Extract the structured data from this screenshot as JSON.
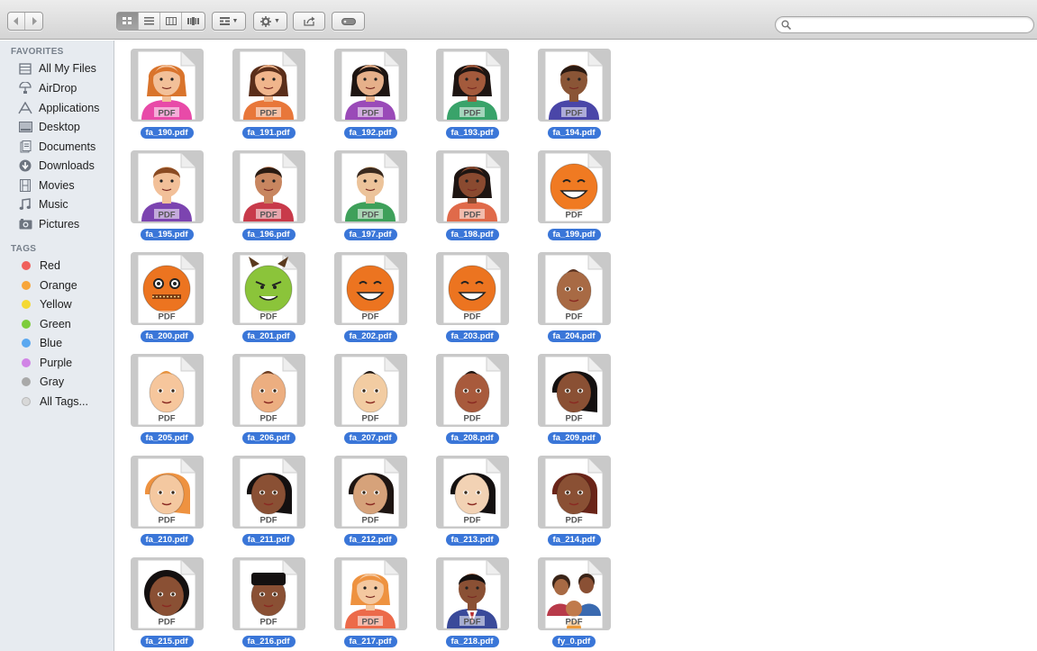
{
  "toolbar": {
    "back_icon": "chevron-left-icon",
    "forward_icon": "chevron-right-icon",
    "view_icons": [
      "icon-view-icon",
      "list-view-icon",
      "column-view-icon",
      "cover-flow-icon"
    ],
    "arrange_icon": "arrange-icon",
    "action_icon": "gear-icon",
    "share_icon": "share-icon",
    "tag_icon": "tag-icon"
  },
  "search": {
    "value": "",
    "placeholder": ""
  },
  "sidebar": {
    "favorites_header": "FAVORITES",
    "favorites": [
      {
        "label": "All My Files",
        "icon": "all-files-icon"
      },
      {
        "label": "AirDrop",
        "icon": "airdrop-icon"
      },
      {
        "label": "Applications",
        "icon": "applications-icon"
      },
      {
        "label": "Desktop",
        "icon": "desktop-icon"
      },
      {
        "label": "Documents",
        "icon": "documents-icon"
      },
      {
        "label": "Downloads",
        "icon": "downloads-icon"
      },
      {
        "label": "Movies",
        "icon": "movies-icon"
      },
      {
        "label": "Music",
        "icon": "music-icon"
      },
      {
        "label": "Pictures",
        "icon": "pictures-icon"
      }
    ],
    "tags_header": "TAGS",
    "tags": [
      {
        "label": "Red",
        "color": "#f0605c"
      },
      {
        "label": "Orange",
        "color": "#f7a53a"
      },
      {
        "label": "Yellow",
        "color": "#f4d934"
      },
      {
        "label": "Green",
        "color": "#7dcc3c"
      },
      {
        "label": "Blue",
        "color": "#5aa8f0"
      },
      {
        "label": "Purple",
        "color": "#d184e6"
      },
      {
        "label": "Gray",
        "color": "#a9a9a9"
      },
      {
        "label": "All Tags...",
        "color": "#d8d8d8"
      }
    ]
  },
  "files": [
    {
      "name": "fa_190.pdf",
      "kind": "woman",
      "skin": "#f2c099",
      "hair": "#d9742c",
      "shirt": "#e84aa8"
    },
    {
      "name": "fa_191.pdf",
      "kind": "woman",
      "skin": "#f0b58c",
      "hair": "#5a2e1a",
      "shirt": "#e8773a"
    },
    {
      "name": "fa_192.pdf",
      "kind": "woman",
      "skin": "#e6b08a",
      "hair": "#1e1512",
      "shirt": "#9a4ab8"
    },
    {
      "name": "fa_193.pdf",
      "kind": "woman",
      "skin": "#a35a3c",
      "hair": "#1e1512",
      "shirt": "#39a36a"
    },
    {
      "name": "fa_194.pdf",
      "kind": "man",
      "skin": "#8a5536",
      "hair": "#2a1a12",
      "shirt": "#4a46a8"
    },
    {
      "name": "fa_195.pdf",
      "kind": "man",
      "skin": "#f2c099",
      "hair": "#8a4a22",
      "shirt": "#7c44b0"
    },
    {
      "name": "fa_196.pdf",
      "kind": "man",
      "skin": "#c88660",
      "hair": "#2a1a12",
      "shirt": "#c83a4a"
    },
    {
      "name": "fa_197.pdf",
      "kind": "man",
      "skin": "#ecc39a",
      "hair": "#3a2a1e",
      "shirt": "#3ea05a"
    },
    {
      "name": "fa_198.pdf",
      "kind": "woman",
      "skin": "#8a4a30",
      "hair": "#1e1512",
      "shirt": "#e06a4a"
    },
    {
      "name": "fa_199.pdf",
      "kind": "smiley",
      "skin": "#f07a22",
      "hair": "#c85a12",
      "shirt": "#f07a22"
    },
    {
      "name": "fa_200.pdf",
      "kind": "zipped",
      "skin": "#ec7420",
      "hair": "#c85a12",
      "shirt": "#ec7420"
    },
    {
      "name": "fa_201.pdf",
      "kind": "devil",
      "skin": "#8bc43a",
      "hair": "#5a3a1e",
      "shirt": "#8bc43a"
    },
    {
      "name": "fa_202.pdf",
      "kind": "smiley",
      "skin": "#ec7420",
      "hair": "#c85a12",
      "shirt": "#ec7420"
    },
    {
      "name": "fa_203.pdf",
      "kind": "smiley",
      "skin": "#ec7420",
      "hair": "#c85a12",
      "shirt": "#ec7420"
    },
    {
      "name": "fa_204.pdf",
      "kind": "baby",
      "skin": "#a86a44",
      "hair": "#5a3220",
      "shirt": "#a86a44"
    },
    {
      "name": "fa_205.pdf",
      "kind": "baby",
      "skin": "#f6c69c",
      "hair": "#e8923c",
      "shirt": "#f6c69c"
    },
    {
      "name": "fa_206.pdf",
      "kind": "baby",
      "skin": "#ecae80",
      "hair": "#6a3a1e",
      "shirt": "#ecae80"
    },
    {
      "name": "fa_207.pdf",
      "kind": "baby",
      "skin": "#f2cca2",
      "hair": "#1e1512",
      "shirt": "#f2cca2"
    },
    {
      "name": "fa_208.pdf",
      "kind": "baby",
      "skin": "#a85a3c",
      "hair": "#1e1512",
      "shirt": "#a85a3c"
    },
    {
      "name": "fa_209.pdf",
      "kind": "bob",
      "skin": "#8a5034",
      "hair": "#141010",
      "shirt": "#8a5034"
    },
    {
      "name": "fa_210.pdf",
      "kind": "bob",
      "skin": "#f4c8a0",
      "hair": "#ee9240",
      "shirt": "#f4c8a0"
    },
    {
      "name": "fa_211.pdf",
      "kind": "bob",
      "skin": "#8a5034",
      "hair": "#141010",
      "shirt": "#8a5034"
    },
    {
      "name": "fa_212.pdf",
      "kind": "bob",
      "skin": "#d6a27a",
      "hair": "#1e1512",
      "shirt": "#d6a27a"
    },
    {
      "name": "fa_213.pdf",
      "kind": "bob",
      "skin": "#f2d2b4",
      "hair": "#141010",
      "shirt": "#f2d2b4"
    },
    {
      "name": "fa_214.pdf",
      "kind": "bob",
      "skin": "#8a5034",
      "hair": "#6a2418",
      "shirt": "#8a5034"
    },
    {
      "name": "fa_215.pdf",
      "kind": "curly",
      "skin": "#8a5034",
      "hair": "#141010",
      "shirt": "#8a5034"
    },
    {
      "name": "fa_216.pdf",
      "kind": "flattop",
      "skin": "#8a5034",
      "hair": "#141010",
      "shirt": "#8a5034"
    },
    {
      "name": "fa_217.pdf",
      "kind": "woman",
      "skin": "#f4c8a0",
      "hair": "#ee9240",
      "shirt": "#ec6a4a"
    },
    {
      "name": "fa_218.pdf",
      "kind": "suit",
      "skin": "#8a5034",
      "hair": "#141010",
      "shirt": "#3a4a9a"
    },
    {
      "name": "fy_0.pdf",
      "kind": "family",
      "skin": "#a86a44",
      "hair": "#3a2418",
      "shirt": "#3a6ab0"
    }
  ],
  "pdf_badge": "PDF"
}
